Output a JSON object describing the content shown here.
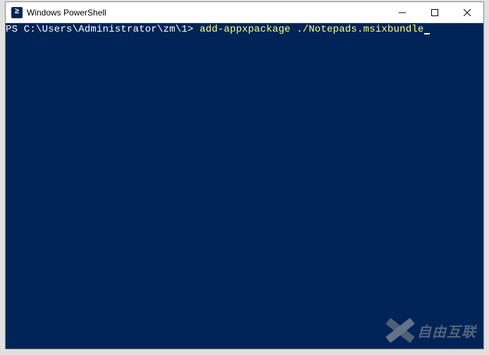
{
  "window": {
    "title": "Windows PowerShell",
    "icon_label": "PS"
  },
  "terminal": {
    "prompt": "PS C:\\Users\\Administrator\\zm\\1> ",
    "command": "add-appxpackage ./Notepads.msixbundle"
  },
  "watermark": {
    "text": "自由互联"
  }
}
